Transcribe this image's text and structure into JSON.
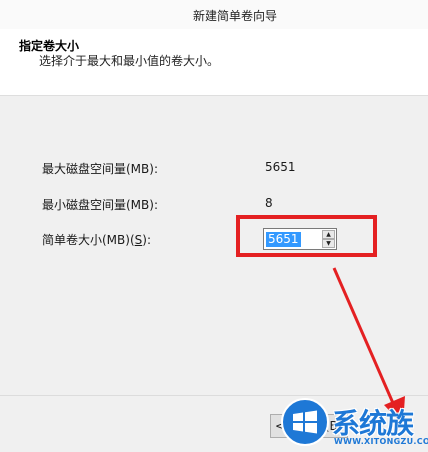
{
  "window": {
    "title": "新建简单卷向导"
  },
  "header": {
    "title": "指定卷大小",
    "description": "选择介于最大和最小值的卷大小。"
  },
  "fields": {
    "max_label": "最大磁盘空间量(MB):",
    "max_value": "5651",
    "min_label": "最小磁盘空间量(MB):",
    "min_value": "8",
    "size_label_prefix": "简单卷大小(MB)(",
    "size_label_key": "S",
    "size_label_suffix": "):",
    "size_value": "5651"
  },
  "footer": {
    "back_label": "< 上一步(B)"
  },
  "watermark": {
    "text": "系统族",
    "url": "WWW.XITONGZU.COM"
  },
  "colors": {
    "highlight": "#e42022",
    "selection": "#3399ff",
    "watermark": "#1e78d6"
  },
  "icons": [
    "spin-up-icon",
    "spin-down-icon",
    "windows-logo-icon",
    "red-arrow-annotation"
  ]
}
